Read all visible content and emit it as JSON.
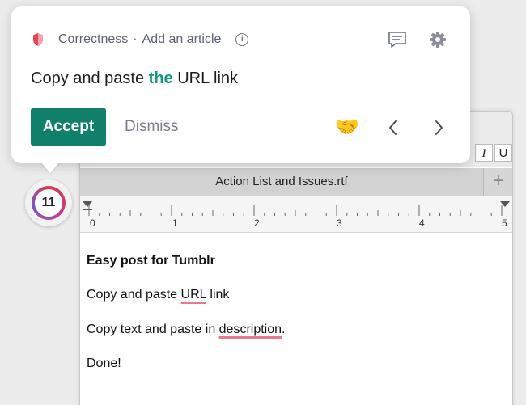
{
  "card": {
    "category": "Correctness",
    "separator": "·",
    "title": "Add an article",
    "info_icon": "i",
    "suggestion_before": "Copy and paste ",
    "suggestion_insert": "the",
    "suggestion_after": " URL link",
    "accept_label": "Accept",
    "dismiss_label": "Dismiss",
    "thanks_emoji": "🤝",
    "accent_color": "#11806a",
    "insert_color": "#15997e",
    "shield_color": "#e8424f"
  },
  "grammarly_button": {
    "count": "11"
  },
  "textedit": {
    "format_buttons": [
      "I",
      "U"
    ],
    "tab_title": "Action List and Issues.rtf",
    "tab_add": "+",
    "ruler_numbers": [
      "0",
      "1",
      "2",
      "3",
      "4",
      "5"
    ]
  },
  "document": {
    "heading": "Easy post for Tumblr",
    "line1_before": "Copy and paste ",
    "line1_flagged": "URL",
    "line1_after": " link",
    "line2_before": "Copy text and paste in ",
    "line2_flagged": "description",
    "line2_after": ".",
    "line3": "Done!",
    "squiggle_color": "#e97a8d"
  }
}
